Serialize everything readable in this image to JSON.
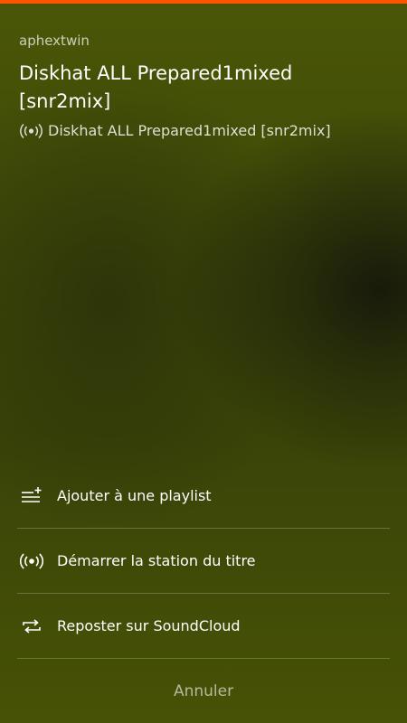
{
  "colors": {
    "accent": "#ff5500",
    "background": "#3f4a07"
  },
  "track": {
    "artist": "aphextwin",
    "title": "Diskhat ALL Prepared1mixed [snr2mix]",
    "station_icon": "radio-station-icon",
    "station_label": "Diskhat ALL Prepared1mixed [snr2mix]"
  },
  "menu": {
    "items": [
      {
        "icon": "add-to-playlist-icon",
        "label": "Ajouter à une playlist"
      },
      {
        "icon": "radio-station-icon",
        "label": "Démarrer la station du titre"
      },
      {
        "icon": "repost-icon",
        "label": "Reposter sur SoundCloud"
      }
    ],
    "cancel_label": "Annuler"
  }
}
